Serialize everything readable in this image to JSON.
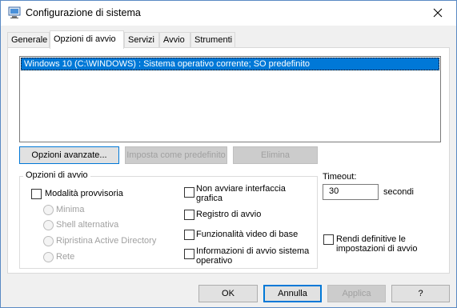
{
  "window": {
    "title": "Configurazione di sistema",
    "icon": "msconfig-icon",
    "close_icon": "close-icon"
  },
  "tabs": [
    {
      "label": "Generale"
    },
    {
      "label": "Opzioni di avvio",
      "active": true
    },
    {
      "label": "Servizi"
    },
    {
      "label": "Avvio"
    },
    {
      "label": "Strumenti"
    }
  ],
  "os_list": {
    "items": [
      "Windows 10 (C:\\WINDOWS) : Sistema operativo corrente; SO predefinito"
    ],
    "selected_index": 0
  },
  "list_buttons": {
    "advanced": "Opzioni avanzate...",
    "set_default": "Imposta come predefinito",
    "delete": "Elimina"
  },
  "boot_options": {
    "title": "Opzioni di avvio",
    "safe_boot": "Modalità provvisoria",
    "minimal": "Minima",
    "alternate_shell": "Shell alternativa",
    "ad_repair": "Ripristina Active Directory",
    "network": "Rete",
    "no_gui_boot": "Non avviare interfaccia grafica",
    "boot_log": "Registro di avvio",
    "base_video": "Funzionalità video di base",
    "os_boot_info": "Informazioni di avvio sistema operativo"
  },
  "timeout": {
    "label": "Timeout:",
    "value": "30",
    "unit": "secondi"
  },
  "permanent": {
    "label": "Rendi definitive le impostazioni di avvio"
  },
  "footer": {
    "ok": "OK",
    "cancel": "Annulla",
    "apply": "Applica",
    "help": "?"
  },
  "colors": {
    "selection": "#0078d7",
    "window_border": "#5a8ac4"
  }
}
